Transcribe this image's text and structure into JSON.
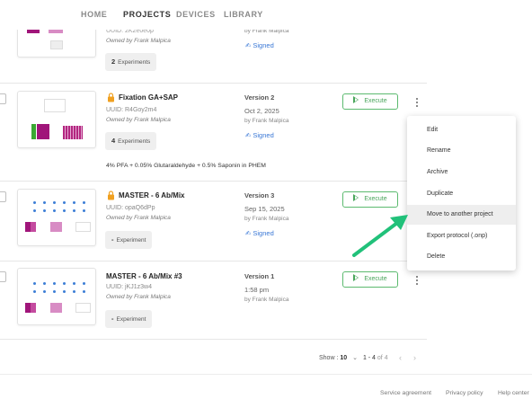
{
  "nav": {
    "items": [
      "HOME",
      "PROJECTS",
      "DEVICES",
      "LIBRARY"
    ],
    "active": "PROJECTS"
  },
  "rows": [
    {
      "name": "",
      "uuid": "UUID: 2K2e0e0p",
      "owned": "Owned by Frank Malpica",
      "experiments_count": "2",
      "experiments_label": "Experiments",
      "version": "",
      "date": "",
      "by": "by Frank Malpica",
      "signed": "Signed"
    },
    {
      "name": "Fixation GA+SAP",
      "locked": true,
      "uuid": "UUID: R4Goy2m4",
      "owned": "Owned by Frank Malpica",
      "experiments_count": "4",
      "experiments_label": "Experiments",
      "version": "Version 2",
      "date": "Oct 2, 2025",
      "by": "by Frank Malpica",
      "signed": "Signed",
      "execute": "Execute",
      "note": "4% PFA + 0.05% Glutaraldehyde + 0.5% Saponin in PHEM"
    },
    {
      "name": "MASTER - 6 Ab/Mix",
      "locked": true,
      "uuid": "UUID: opaQ6dPp",
      "owned": "Owned by Frank Malpica",
      "experiments_count": "-",
      "experiments_label": "Experiment",
      "version": "Version 3",
      "date": "Sep 15, 2025",
      "by": "by Frank Malpica",
      "signed": "Signed",
      "execute": "Execute"
    },
    {
      "name": "MASTER - 6 Ab/Mix #3",
      "locked": false,
      "uuid": "UUID: jKJ1z3w4",
      "owned": "Owned by Frank Malpica",
      "experiments_count": "-",
      "experiments_label": "Experiment",
      "version": "Version 1",
      "date": "1:58 pm",
      "by": "by Frank Malpica",
      "execute": "Execute"
    }
  ],
  "context_menu": {
    "items": [
      "Edit",
      "Rename",
      "Archive",
      "Duplicate",
      "Move to another project",
      "Export protocol (.onp)",
      "Delete"
    ],
    "highlighted": "Move to another project"
  },
  "pagination": {
    "show_label": "Show :",
    "page_size": "10",
    "range": "1 - 4",
    "of_label": "of 4"
  },
  "footer": {
    "links": [
      "Service agreement",
      "Privacy policy",
      "Help center"
    ]
  },
  "colors": {
    "execute_green": "#4aa65c",
    "signed_blue": "#3a78d6",
    "lock_orange": "#f0a020",
    "arrow_green": "#21c17a",
    "well_magenta": "#a0157a",
    "well_pink": "#d88cc4",
    "well_green": "#3aa832",
    "dot_blue": "#3d7fd6"
  }
}
